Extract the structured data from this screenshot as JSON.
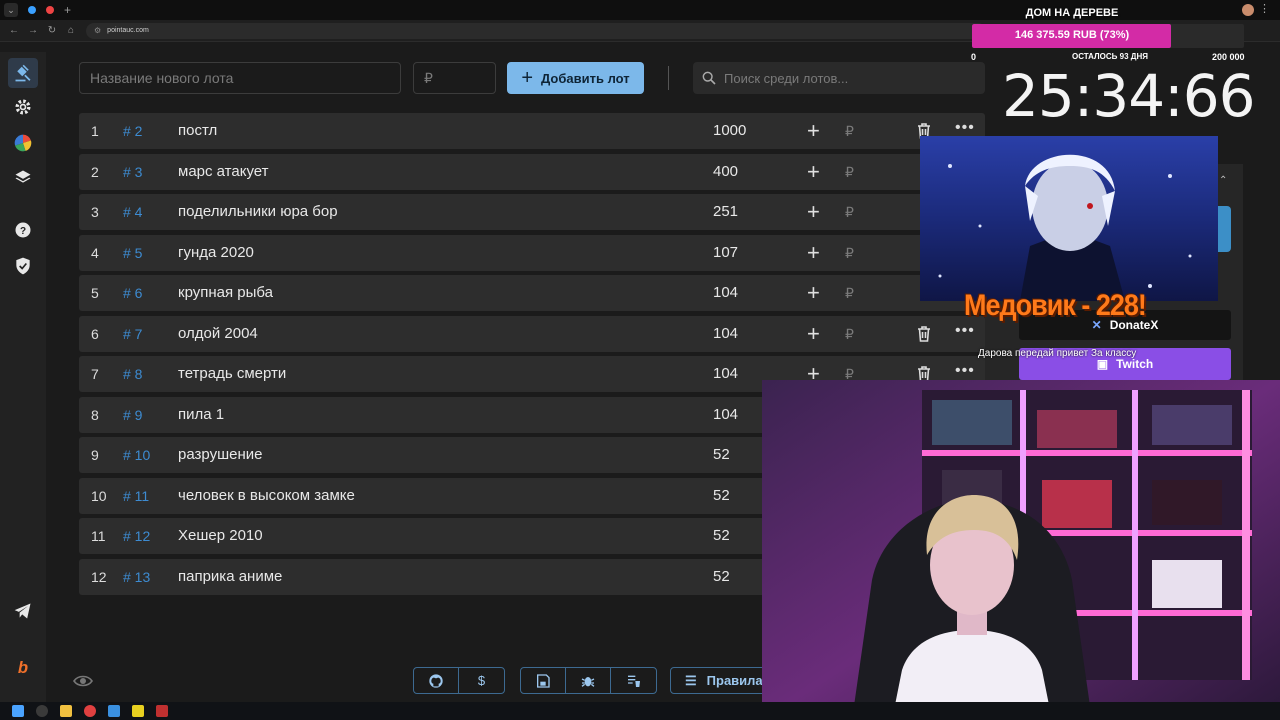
{
  "browser": {
    "url": "pointauc.com"
  },
  "toolbar": {
    "lot_name_placeholder": "Название нового лота",
    "price_placeholder": "₽",
    "add_button_label": "Добавить лот",
    "search_placeholder": "Поиск среди лотов..."
  },
  "lots": [
    {
      "num": "1",
      "id": "# 2",
      "name": "постл",
      "amount": "1000",
      "currency": "₽"
    },
    {
      "num": "2",
      "id": "# 3",
      "name": "марс атакует",
      "amount": "400",
      "currency": "₽"
    },
    {
      "num": "3",
      "id": "# 4",
      "name": "поделильники юра бор",
      "amount": "251",
      "currency": "₽"
    },
    {
      "num": "4",
      "id": "# 5",
      "name": "гунда 2020",
      "amount": "107",
      "currency": "₽"
    },
    {
      "num": "5",
      "id": "# 6",
      "name": "крупная рыба",
      "amount": "104",
      "currency": "₽"
    },
    {
      "num": "6",
      "id": "# 7",
      "name": "олдой 2004",
      "amount": "104",
      "currency": "₽"
    },
    {
      "num": "7",
      "id": "# 8",
      "name": "тетрадь смерти",
      "amount": "104",
      "currency": "₽"
    },
    {
      "num": "8",
      "id": "# 9",
      "name": "пила 1",
      "amount": "104",
      "currency": "₽"
    },
    {
      "num": "9",
      "id": "# 10",
      "name": "разрушение",
      "amount": "52",
      "currency": "₽"
    },
    {
      "num": "10",
      "id": "# 11",
      "name": "человек в высоком замке",
      "amount": "52",
      "currency": "₽"
    },
    {
      "num": "11",
      "id": "# 12",
      "name": "Хешер 2010",
      "amount": "52",
      "currency": "₽"
    },
    {
      "num": "12",
      "id": "# 13",
      "name": "паприка аниме",
      "amount": "52",
      "currency": "₽"
    }
  ],
  "bottom": {
    "dollar_label": "$",
    "rules_label": "Правила"
  },
  "overlay": {
    "goal_title": "ДОМ НА ДЕРЕВЕ",
    "goal_amount": "146 375.59 RUB (73%)",
    "goal_progress": 0.73,
    "goal_min": "0",
    "goal_remaining": "ОСТАЛОСЬ 93 ДНЯ",
    "goal_max": "200 000",
    "timer": "25:34:66",
    "alert_name": "Медовик - 228!",
    "alert_message": "Дарова передай привет  За классу",
    "donatex_label": "DonateX",
    "twitch_label": "Twitch"
  },
  "colors": {
    "accent": "#7cb8ea",
    "lot_id": "#3d8bd1",
    "goal_fill": "#d32ba6",
    "twitch": "#8a4ee6"
  }
}
